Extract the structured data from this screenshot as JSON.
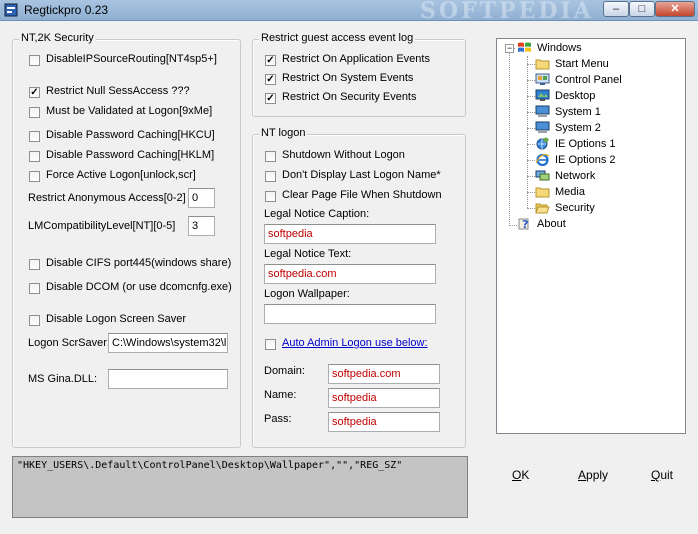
{
  "window": {
    "title": "Regtickpro 0.23",
    "watermark": "SOFTPEDIA"
  },
  "nt2k": {
    "title": "NT,2K Security",
    "disable_ip_source_routing": {
      "label": "DisableIPSourceRouting[NT4sp5+]",
      "checked": false
    },
    "restrict_null_sess": {
      "label": "Restrict  Null SessAccess ???",
      "checked": true
    },
    "must_validate": {
      "label": "Must be Validated at Logon[9xMe]",
      "checked": false
    },
    "disable_pw_cache_hkcu": {
      "label": "Disable Password Caching[HKCU]",
      "checked": false
    },
    "disable_pw_cache_hklm": {
      "label": "Disable Password Caching[HKLM]",
      "checked": false
    },
    "force_active_logon": {
      "label": "Force Active Logon[unlock,scr]",
      "checked": false
    },
    "restrict_anon_label": "Restrict Anonymous Access[0-2]",
    "restrict_anon_value": "0",
    "lmcompat_label": "LMCompatibilityLevel[NT][0-5]",
    "lmcompat_value": "3",
    "disable_cifs": {
      "label": "Disable CIFS port445(windows share)",
      "checked": false
    },
    "disable_dcom": {
      "label": "Disable DCOM (or use dcomcnfg.exe)",
      "checked": false
    },
    "disable_logon_saver": {
      "label": "Disable Logon Screen Saver",
      "checked": false
    },
    "logon_scrsaver_label": "Logon ScrSaver:",
    "logon_scrsaver_value": "C:\\Windows\\system32\\l",
    "ms_gina_label": "MS Gina.DLL:",
    "ms_gina_value": ""
  },
  "guest": {
    "title": "Restrict guest access event log",
    "app_events": {
      "label": "Restrict On Application Events",
      "checked": true
    },
    "sys_events": {
      "label": "Restrict On System Events",
      "checked": true
    },
    "sec_events": {
      "label": "Restrict On Security Events",
      "checked": true
    }
  },
  "ntlogon": {
    "title": "NT logon",
    "shutdown_without_logon": {
      "label": "Shutdown Without Logon",
      "checked": false
    },
    "dont_display_last": {
      "label": "Don't Display Last Logon Name*",
      "checked": false
    },
    "clear_pagefile": {
      "label": "Clear Page File When Shutdown",
      "checked": false
    },
    "caption_label": "Legal Notice Caption:",
    "caption_value": "softpedia",
    "text_label": "Legal Notice Text:",
    "text_value": "softpedia.com",
    "wallpaper_label": "Logon Wallpaper:",
    "wallpaper_value": "",
    "auto_admin": {
      "label": "Auto Admin Logon use below:",
      "checked": false
    },
    "domain_label": "Domain:",
    "domain_value": "softpedia.com",
    "name_label": "Name:",
    "name_value": "softpedia",
    "pass_label": "Pass:",
    "pass_value": "softpedia"
  },
  "tree": {
    "root": "Windows",
    "items": [
      "Start Menu",
      "Control Panel",
      "Desktop",
      "System 1",
      "System 2",
      "IE Options 1",
      "IE Options 2",
      "Network",
      "Media",
      "Security"
    ],
    "about": "About",
    "expander": "−"
  },
  "status": {
    "text": "\"HKEY_USERS\\.Default\\ControlPanel\\Desktop\\Wallpaper\",\"\",\"REG_SZ\""
  },
  "buttons": {
    "ok": {
      "mnemonic": "O",
      "rest": "K"
    },
    "apply": {
      "mnemonic": "A",
      "rest": "pply"
    },
    "quit": {
      "mnemonic": "Q",
      "rest": "uit"
    }
  },
  "colors": {
    "title_bar": "#a9c4e0",
    "red_text": "#c00000",
    "link": "#0000cc",
    "status_bg": "#c4c4c4"
  }
}
